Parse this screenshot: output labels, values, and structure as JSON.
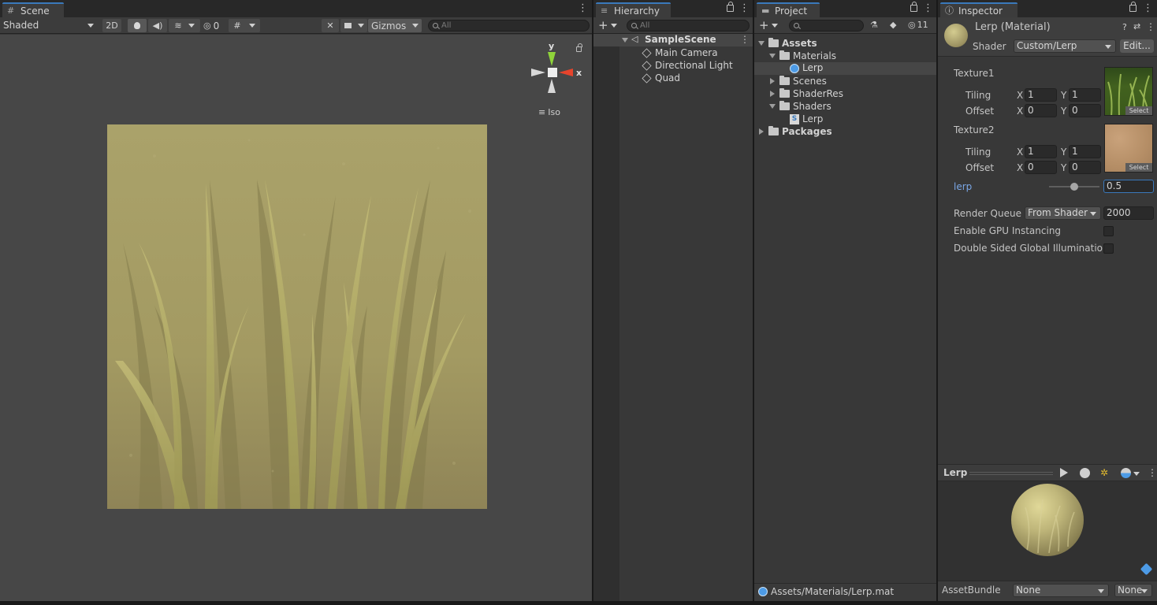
{
  "scene": {
    "tab_label": "Scene",
    "shading_mode": "Shaded",
    "btn_2d": "2D",
    "hidden_count": "0",
    "gizmos_label": "Gizmos",
    "search_placeholder": "All",
    "gizmo_y": "y",
    "gizmo_x": "x",
    "projection_label": "Iso"
  },
  "hierarchy": {
    "tab_label": "Hierarchy",
    "search_placeholder": "All",
    "scene_name": "SampleScene",
    "objects": [
      "Main Camera",
      "Directional Light",
      "Quad"
    ]
  },
  "project": {
    "tab_label": "Project",
    "hidden_count": "11",
    "tree": {
      "assets": "Assets",
      "materials": "Materials",
      "lerp_material": "Lerp",
      "scenes": "Scenes",
      "shaderres": "ShaderRes",
      "shaders": "Shaders",
      "lerp_shader": "Lerp",
      "packages": "Packages"
    },
    "status_path": "Assets/Materials/Lerp.mat"
  },
  "inspector": {
    "tab_label": "Inspector",
    "material_title": "Lerp (Material)",
    "shader_label": "Shader",
    "shader_value": "Custom/Lerp",
    "edit_button": "Edit...",
    "texture1": {
      "label": "Texture1",
      "tiling_label": "Tiling",
      "offset_label": "Offset",
      "tiling_x": "1",
      "tiling_y": "1",
      "offset_x": "0",
      "offset_y": "0",
      "select_label": "Select"
    },
    "texture2": {
      "label": "Texture2",
      "tiling_label": "Tiling",
      "offset_label": "Offset",
      "tiling_x": "1",
      "tiling_y": "1",
      "offset_x": "0",
      "offset_y": "0",
      "select_label": "Select"
    },
    "axis_x": "X",
    "axis_y": "Y",
    "lerp_label": "lerp",
    "lerp_value": "0.5",
    "lerp_slider_fraction": 0.5,
    "render_queue_label": "Render Queue",
    "render_queue_mode": "From Shader",
    "render_queue_value": "2000",
    "gpu_instancing_label": "Enable GPU Instancing",
    "gpu_instancing_checked": false,
    "double_sided_gi_label": "Double Sided Global Illumination",
    "double_sided_gi_checked": false,
    "preview_title": "Lerp",
    "assetbundle_label": "AssetBundle",
    "assetbundle_name": "None",
    "assetbundle_variant": "None"
  },
  "colors": {
    "accent": "#3a79bb",
    "lerp_label": "#7aa7e6",
    "gizmo_x": "#e6442c",
    "gizmo_y": "#8fd43a"
  }
}
